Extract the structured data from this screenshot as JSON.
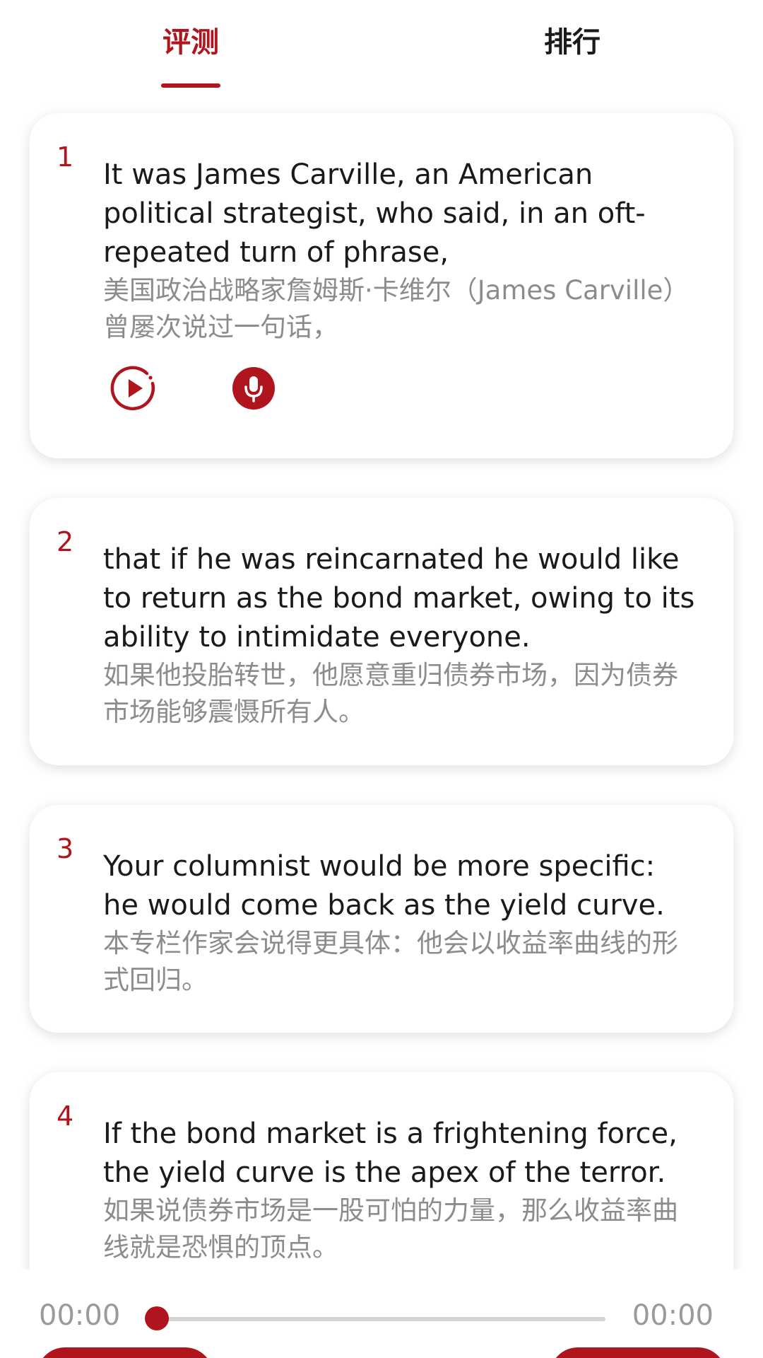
{
  "colors": {
    "accent": "#b0151e",
    "text_primary": "#1a1a1a",
    "text_secondary": "#8c8c8c",
    "track": "#d4d4d4"
  },
  "tabs": [
    {
      "label": "评测",
      "active": true
    },
    {
      "label": "排行",
      "active": false
    }
  ],
  "sentences": [
    {
      "number": "1",
      "english": "It was James Carville, an American political strategist, who said, in an oft-repeated turn of phrase,",
      "chinese": "美国政治战略家詹姆斯·卡维尔（James Carville）曾屡次说过一句话，",
      "actions": {
        "play_icon": "play-circle-icon",
        "record_icon": "microphone-icon"
      }
    },
    {
      "number": "2",
      "english": "that if he was reincarnated he would like to return as the bond market, owing to its ability to intimidate everyone.",
      "chinese": "如果他投胎转世，他愿意重归债券市场，因为债券市场能够震慑所有人。"
    },
    {
      "number": "3",
      "english": "Your columnist would be more specific: he would come back as the yield curve.",
      "chinese": "本专栏作家会说得更具体：他会以收益率曲线的形式回归。"
    },
    {
      "number": "4",
      "english": "If the bond market is a frightening force, the yield curve is the apex of the terror.",
      "chinese": "如果说债券市场是一股可怕的力量，那么收益率曲线就是恐惧的顶点。"
    }
  ],
  "player": {
    "current_time": "00:00",
    "total_time": "00:00",
    "progress": 0
  }
}
